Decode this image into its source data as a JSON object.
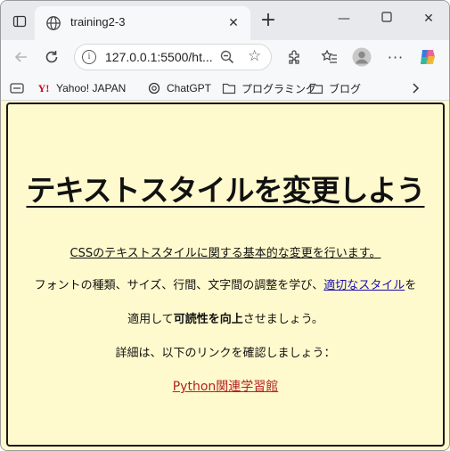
{
  "browser": {
    "tab_title": "training2-3",
    "url": "127.0.0.1:5500/ht...",
    "bookmarks": [
      {
        "label": "Yahoo! JAPAN",
        "icon": "yahoo-icon"
      },
      {
        "label": "ChatGPT",
        "icon": "chatgpt-icon"
      },
      {
        "label": "プログラミング",
        "icon": "folder-icon"
      },
      {
        "label": "ブログ",
        "icon": "folder-icon"
      }
    ]
  },
  "page": {
    "heading": "テキストスタイルを変更しよう",
    "intro": "CSSのテキストスタイルに関する基本的な変更を行います。",
    "line2_before": "フォントの種類、サイズ、行間、文字間の調整を学び、",
    "line2_link": "適切なスタイル",
    "line2_after": "を",
    "line3_before": "適用して",
    "line3_bold": "可読性を向上",
    "line3_after": "させましょう。",
    "line4": "詳細は、以下のリンクを確認しましょう：",
    "python_link": "Python関連学習館",
    "colors": {
      "background": "#fffacd",
      "link": "#1a0dab",
      "python_link": "#b22222"
    }
  }
}
